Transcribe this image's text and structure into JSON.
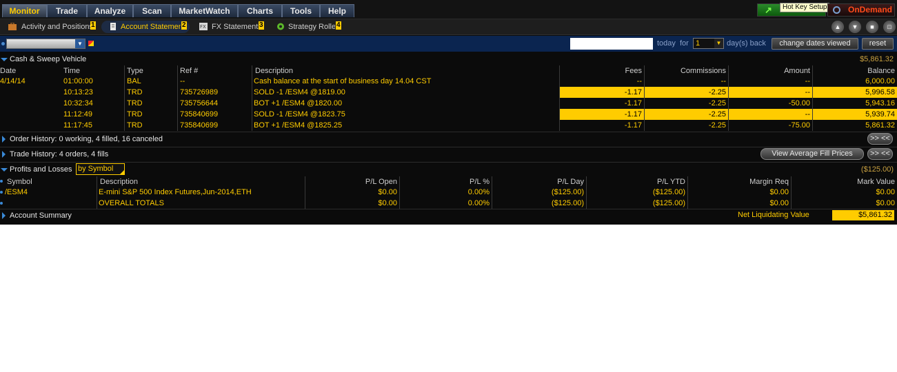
{
  "nav": {
    "tabs": [
      "Monitor",
      "Trade",
      "Analyze",
      "Scan",
      "MarketWatch",
      "Charts",
      "Tools",
      "Help"
    ],
    "active_tab": "Monitor",
    "hotkey_label": "Hot Key Setup",
    "ondemand_label": "OnDemand"
  },
  "subnav": {
    "items": [
      {
        "label": "Activity and Positions",
        "num": "1"
      },
      {
        "label": "Account Statement",
        "num": "2"
      },
      {
        "label": "FX Statements",
        "num": "3"
      },
      {
        "label": "Strategy Roller",
        "num": "4"
      }
    ],
    "active": "Account Statement"
  },
  "controls": {
    "today_label": "today",
    "for_label": "for",
    "days_value": "1",
    "days_back_label": "day(s) back",
    "change_dates_label": "change dates viewed",
    "reset_label": "reset"
  },
  "cash": {
    "title": "Cash & Sweep Vehicle",
    "total": "$5,861.32",
    "columns": [
      "Date",
      "Time",
      "Type",
      "Ref #",
      "Description",
      "Fees",
      "Commissions",
      "Amount",
      "Balance"
    ],
    "rows": [
      {
        "date": "4/14/14",
        "time": "01:00:00",
        "type": "BAL",
        "ref": "--",
        "desc": "Cash balance at the start of business day 14.04 CST",
        "fees": "--",
        "comm": "--",
        "amount": "--",
        "balance": "6,000.00"
      },
      {
        "date": "",
        "time": "10:13:23",
        "type": "TRD",
        "ref": "735726989",
        "desc": "SOLD -1 /ESM4 @1819.00",
        "fees": "-1.17",
        "comm": "-2.25",
        "amount": "--",
        "balance": "5,996.58"
      },
      {
        "date": "",
        "time": "10:32:34",
        "type": "TRD",
        "ref": "735756644",
        "desc": "BOT +1 /ESM4 @1820.00",
        "fees": "-1.17",
        "comm": "-2.25",
        "amount": "-50.00",
        "balance": "5,943.16"
      },
      {
        "date": "",
        "time": "11:12:49",
        "type": "TRD",
        "ref": "735840699",
        "desc": "SOLD -1 /ESM4 @1823.75",
        "fees": "-1.17",
        "comm": "-2.25",
        "amount": "--",
        "balance": "5,939.74"
      },
      {
        "date": "",
        "time": "11:17:45",
        "type": "TRD",
        "ref": "735840699",
        "desc": "BOT +1 /ESM4 @1825.25",
        "fees": "-1.17",
        "comm": "-2.25",
        "amount": "-75.00",
        "balance": "5,861.32"
      }
    ]
  },
  "order_history": {
    "title": "Order History: 0 working, 4 filled, 16 canceled",
    "button": ">> <<"
  },
  "trade_history": {
    "title": "Trade History: 4 orders, 4 fills",
    "avg_fill_button": "View Average Fill Prices",
    "button": ">> <<"
  },
  "pnl": {
    "title": "Profits and Losses",
    "group_by": "by Symbol",
    "total": "($125.00)",
    "columns": [
      "Symbol",
      "Description",
      "P/L Open",
      "P/L %",
      "P/L Day",
      "P/L YTD",
      "Margin Req",
      "Mark Value"
    ],
    "rows": [
      {
        "symbol": "/ESM4",
        "desc": "E-mini S&P 500 Index Futures,Jun-2014,ETH",
        "open": "$0.00",
        "pct": "0.00%",
        "day": "($125.00)",
        "ytd": "($125.00)",
        "margin": "$0.00",
        "mark": "$0.00"
      },
      {
        "symbol": "",
        "desc": "OVERALL TOTALS",
        "open": "$0.00",
        "pct": "0.00%",
        "day": "($125.00)",
        "ytd": "($125.00)",
        "margin": "$0.00",
        "mark": "$0.00"
      }
    ]
  },
  "summary": {
    "title": "Account Summary",
    "nlv_label": "Net Liquidating Value",
    "nlv_value": "$5,861.32"
  }
}
